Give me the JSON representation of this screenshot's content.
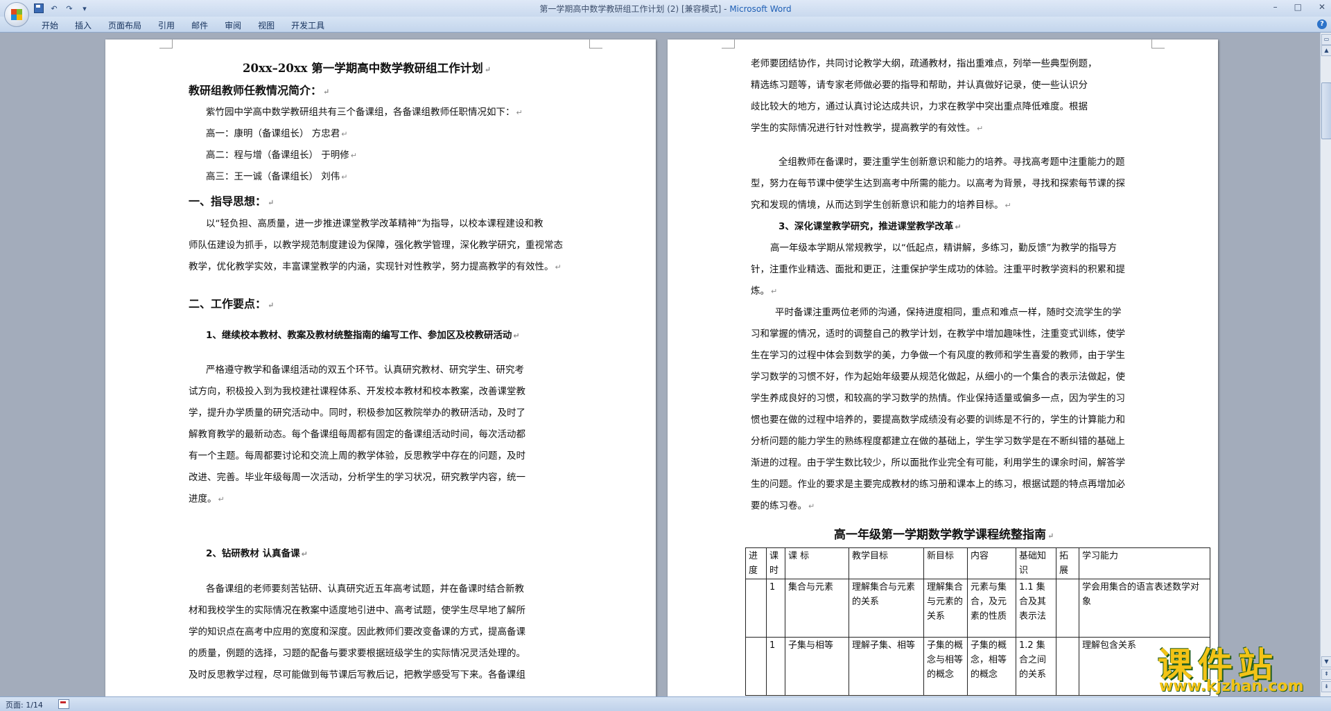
{
  "window": {
    "title_doc": "第一学期高中数学教研组工作计划 (2) [兼容模式] - ",
    "title_app": "Microsoft Word",
    "minimize": "–",
    "maximize": "□",
    "close": "✕"
  },
  "quick_access": {
    "undo_symbol": "↶",
    "redo_symbol": "↷",
    "customize_symbol": "▾"
  },
  "ribbon": {
    "tabs": [
      "开始",
      "插入",
      "页面布局",
      "引用",
      "邮件",
      "审阅",
      "视图",
      "开发工具"
    ],
    "help_symbol": "?"
  },
  "page1": {
    "title": "20xx–20xx 第一学期高中数学教研组工作计划",
    "lines": [
      "教研组教师任教情况简介：",
      "紫竹园中学高中数学教研组共有三个备课组，各备课组教师任职情况如下：",
      "高一：康明（备课组长）   方忠君",
      "高二：程与增（备课组长）   于明修",
      "高三：王一诚（备课组长）   刘伟",
      "一、指导思想：",
      "以“轻负担、高质量，进一步推进课堂教学改革精神”为指导，以校本课程建设和教",
      "师队伍建设为抓手，以教学规范制度建设为保障，强化教学管理，深化教学研究，重视常态",
      "教学，优化教学实效，丰富课堂教学的内涵，实现针对性教学，努力提高教学的有效性。",
      "二、工作要点：",
      "1、继续校本教材、教案及教材统整指南的编写工作、参加区及校教研活动",
      "严格遵守教学和备课组活动的双五个环节。认真研究教材、研究学生、研究考",
      "试方向，积极投入到为我校建社课程体系、开发校本教材和校本教案，改善课堂教",
      "学，提升办学质量的研究活动中。同时，积极参加区教院举办的教研活动，及时了",
      "解教育教学的最新动态。每个备课组每周都有固定的备课组活动时间，每次活动都",
      "有一个主题。每周都要讨论和交流上周的教学体验，反思教学中存在的问题，及时",
      "改进、完善。毕业年级每周一次活动，分析学生的学习状况，研究教学内容，统一",
      "进度。",
      "2、钻研教材  认真备课",
      "各备课组的老师要刻苦钻研、认真研究近五年高考试题，并在备课时结合新教",
      "材和我校学生的实际情况在教案中适度地引进中、高考试题，使学生尽早地了解所",
      "学的知识点在高考中应用的宽度和深度。因此教师们要改变备课的方式，提高备课",
      "的质量，例题的选择，习题的配备与要求要根据班级学生的实际情况灵活处理的。",
      "及时反思教学过程，尽可能做到每节课后写教后记，把教学感受写下来。各备课组"
    ]
  },
  "page2": {
    "lines": [
      "老师要团结协作，共同讨论教学大纲，疏通教材，指出重难点，列举一些典型例题，",
      "精选练习题等，请专家老师做必要的指导和帮助，并认真做好记录，使一些认识分",
      "歧比较大的地方，通过认真讨论达成共识，力求在教学中突出重点降低难度。根据",
      "学生的实际情况进行针对性教学，提高教学的有效性。",
      "全组教师在备课时，要注重学生创新意识和能力的培养。寻找高考题中注重能力的题",
      "型，努力在每节课中使学生达到高考中所需的能力。以高考为背景，寻找和探索每节课的探",
      "究和发现的情境，从而达到学生创新意识和能力的培养目标。",
      "3、深化课堂教学研究，推进课堂教学改革",
      "高一年级本学期从常规教学，以“低起点，精讲解，多练习，勤反馈”为教学的指导方",
      "针，注重作业精选、面批和更正，注重保护学生成功的体验。注重平时教学资料的积累和提",
      "炼。",
      "平时备课注重两位老师的沟通，保持进度相同，重点和难点一样，随时交流学生的学",
      "习和掌握的情况，适时的调整自己的教学计划，在教学中增加趣味性，注重变式训练，使学",
      "生在学习的过程中体会到数学的美，力争做一个有风度的教师和学生喜爱的教师，由于学生",
      "学习数学的习惯不好，作为起始年级要从规范化做起，从细小的一个集合的表示法做起，使",
      "学生养成良好的习惯，和较高的学习数学的热情。作业保持适量或偏多一点，因为学生的习",
      "惯也要在做的过程中培养的，要提高数学成绩没有必要的训练是不行的，学生的计算能力和",
      "分析问题的能力学生的熟练程度都建立在做的基础上，学生学习数学是在不断纠错的基础上",
      "渐进的过程。由于学生数比较少，所以面批作业完全有可能，利用学生的课余时间，解答学",
      "生的问题。作业的要求是主要完成教材的练习册和课本上的练习，根据试题的特点再增加必",
      "要的练习卷。"
    ],
    "table_title": "高一年级第一学期数学教学课程统整指南",
    "table": {
      "headers": [
        "进度",
        "课时",
        "课    标",
        "教学目标",
        "新目标",
        "内容",
        "基础知识",
        "拓展",
        "学习能力"
      ],
      "rows": [
        [
          "",
          "1",
          "集合与元素",
          "理解集合与元素的关系",
          "理解集合与元素的关系",
          "元素与集合，及元素的性质",
          "1.1  集合及其表示法",
          "",
          "学会用集合的语言表述数学对象"
        ],
        [
          "",
          "1",
          "子集与相等",
          "理解子集、相等",
          "子集的概念与相等的概念",
          "子集的概念，相等的概念",
          "1.2  集合之间的关系",
          "",
          "理解包含关系"
        ]
      ]
    }
  },
  "status": {
    "page_info": "页面: 1/14"
  },
  "watermark": {
    "text": "课件站",
    "url": "www.kjzhan.com"
  }
}
